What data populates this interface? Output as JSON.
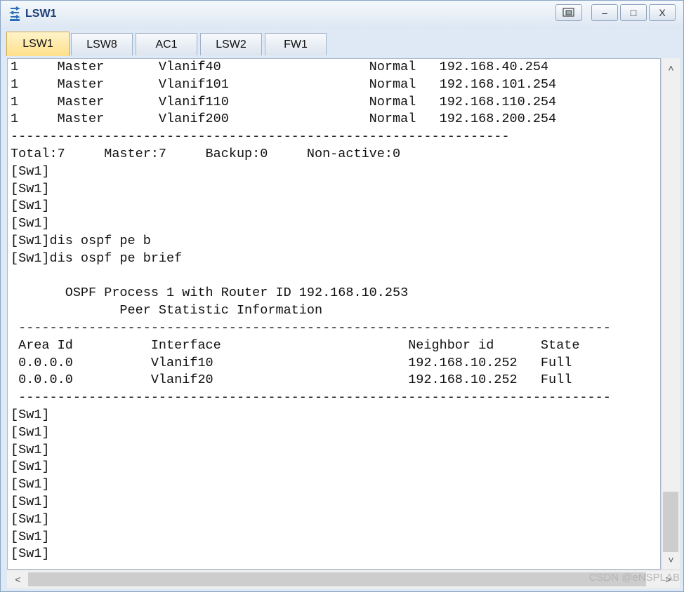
{
  "window": {
    "title": "LSW1",
    "icon": "switch-app-icon",
    "controls": [
      {
        "name": "restore-layout-button",
        "label": "⧉"
      },
      {
        "name": "minimize-button",
        "label": "–"
      },
      {
        "name": "maximize-button",
        "label": "□"
      },
      {
        "name": "close-button",
        "label": "X"
      }
    ]
  },
  "tabs": [
    {
      "label": "LSW1",
      "active": true
    },
    {
      "label": "LSW8",
      "active": false
    },
    {
      "label": "AC1",
      "active": false
    },
    {
      "label": "LSW2",
      "active": false
    },
    {
      "label": "FW1",
      "active": false
    }
  ],
  "terminal": {
    "lines": [
      "1     Master       Vlanif40                   Normal   192.168.40.254",
      "1     Master       Vlanif101                  Normal   192.168.101.254",
      "1     Master       Vlanif110                  Normal   192.168.110.254",
      "1     Master       Vlanif200                  Normal   192.168.200.254",
      "----------------------------------------------------------------",
      "Total:7     Master:7     Backup:0     Non-active:0",
      "[Sw1]",
      "[Sw1]",
      "[Sw1]",
      "[Sw1]",
      "[Sw1]dis ospf pe b",
      "[Sw1]dis ospf pe brief",
      "",
      "       OSPF Process 1 with Router ID 192.168.10.253",
      "              Peer Statistic Information",
      " ----------------------------------------------------------------------------",
      " Area Id          Interface                        Neighbor id      State",
      " 0.0.0.0          Vlanif10                         192.168.10.252   Full",
      " 0.0.0.0          Vlanif20                         192.168.10.252   Full",
      " ----------------------------------------------------------------------------",
      "[Sw1]",
      "[Sw1]",
      "[Sw1]",
      "[Sw1]",
      "[Sw1]",
      "[Sw1]",
      "[Sw1]",
      "[Sw1]",
      "[Sw1]"
    ]
  },
  "scrollbars": {
    "vertical": {
      "up_icon": "chevron-up-icon",
      "down_icon": "chevron-down-icon",
      "up_glyph": "˄",
      "down_glyph": "˅",
      "position": 1.0
    },
    "horizontal": {
      "left_icon": "chevron-left-icon",
      "right_icon": "chevron-right-icon",
      "left_glyph": "<",
      "right_glyph": ">"
    }
  },
  "watermark": "CSDN @eNSPLAB",
  "colors": {
    "active_tab": "#ffe08a",
    "title_text": "#1b3f75",
    "terminal_bg": "#ffffff"
  }
}
